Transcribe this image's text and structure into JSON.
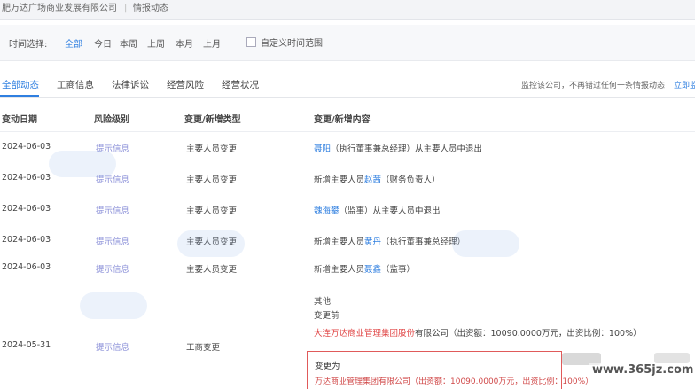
{
  "breadcrumb": {
    "company": "肥万达广场商业发展有限公司",
    "separator": "|",
    "section": "情报动态"
  },
  "filters": {
    "label": "时间选择:",
    "options": [
      "全部",
      "今日",
      "本周",
      "上周",
      "本月",
      "上月"
    ],
    "active_index": 0,
    "custom_range": "自定义时间范围"
  },
  "tabs": {
    "items": [
      "全部动态",
      "工商信息",
      "法律诉讼",
      "经营风险",
      "经营状况"
    ],
    "active_index": 0,
    "note": "监控该公司，不再错过任何一条情报动态",
    "note_link": "立即监"
  },
  "table": {
    "headers": [
      "变动日期",
      "风险级别",
      "变更/新增类型",
      "变更/新增内容"
    ],
    "rows": [
      {
        "date": "2024-06-03",
        "risk": "提示信息",
        "type": "主要人员变更",
        "pre": "",
        "name": "聂阳",
        "post": "（执行董事兼总经理）从主要人员中退出"
      },
      {
        "date": "2024-06-03",
        "risk": "提示信息",
        "type": "主要人员变更",
        "pre": "新增主要人员",
        "name": "赵茜",
        "post": "（财务负责人）"
      },
      {
        "date": "2024-06-03",
        "risk": "提示信息",
        "type": "主要人员变更",
        "pre": "",
        "name": "魏海攀",
        "post": "（监事）从主要人员中退出"
      },
      {
        "date": "2024-06-03",
        "risk": "提示信息",
        "type": "主要人员变更",
        "pre": "新增主要人员",
        "name": "黄丹",
        "post": "（执行董事兼总经理）"
      },
      {
        "date": "2024-06-03",
        "risk": "提示信息",
        "type": "主要人员变更",
        "pre": "新增主要人员",
        "name": "聂鑫",
        "post": "（监事）"
      }
    ],
    "last_row": {
      "date": "2024-05-31",
      "risk": "提示信息",
      "type": "工商变更",
      "field": "其他",
      "before_label": "变更前",
      "before_holder": "大连万达商业管理集团股份",
      "before_rest": "有限公司（出资额：10090.0000万元，出资比例：100%）",
      "after_label": "变更为",
      "after_text": "万达商业管理集团有限公司（出资额：10090.0000万元，出资比例：100%）"
    }
  },
  "watermark": {
    "site": "www.365jz.com"
  },
  "colors": {
    "accent": "#2f7fe0",
    "risk": "#8a8fd8",
    "highlight_box": "#e05a5a"
  }
}
